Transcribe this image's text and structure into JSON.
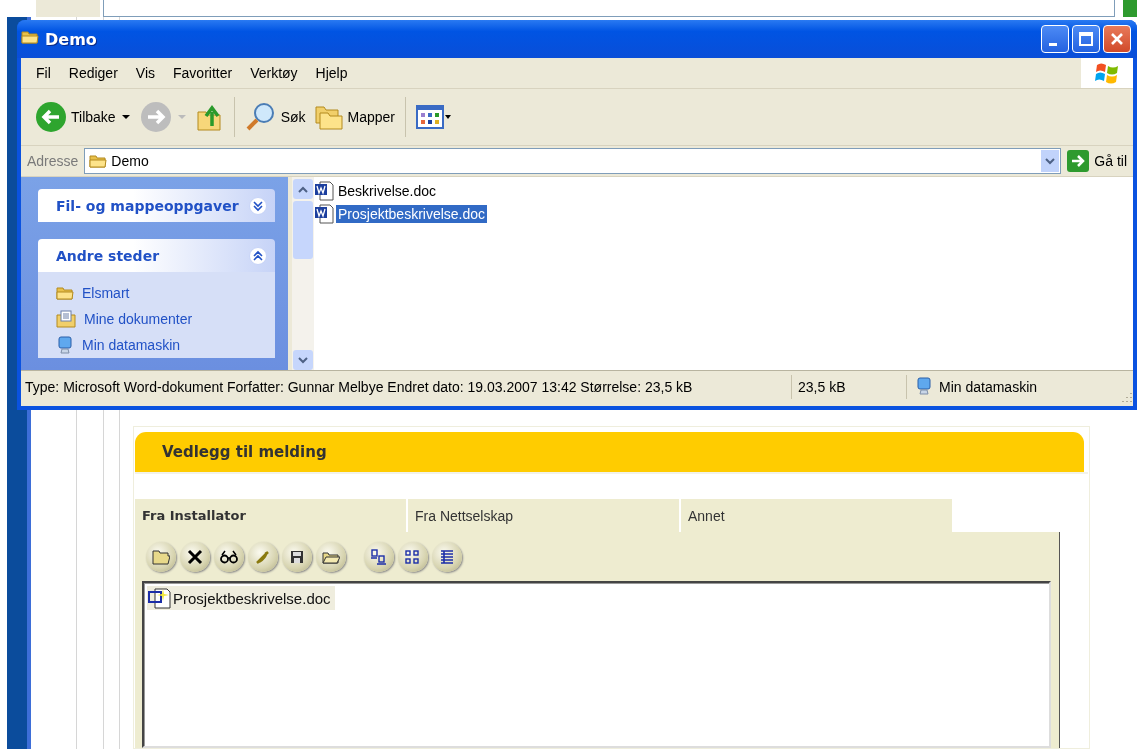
{
  "explorer": {
    "title": "Demo",
    "menu": [
      "Fil",
      "Rediger",
      "Vis",
      "Favoritter",
      "Verktøy",
      "Hjelp"
    ],
    "toolbar": [
      {
        "kind": "back",
        "label": "Tilbake",
        "disabled": false
      },
      {
        "kind": "forward",
        "disabled": true
      },
      {
        "kind": "up"
      },
      {
        "kind": "search",
        "label": "Søk"
      },
      {
        "kind": "folders",
        "label": "Mapper"
      },
      {
        "kind": "views"
      }
    ],
    "address": {
      "label": "Adresse",
      "value": "Demo",
      "go": "Gå til"
    },
    "task_panels": [
      {
        "title": "Fil- og mappeoppgaver",
        "expanded": false
      },
      {
        "title": "Andre steder",
        "expanded": true,
        "items": [
          {
            "label": "Elsmart",
            "kind": "folder"
          },
          {
            "label": "Mine dokumenter",
            "kind": "documents"
          },
          {
            "label": "Min datamaskin",
            "kind": "computer"
          }
        ]
      }
    ],
    "files": [
      {
        "name": "Beskrivelse.doc",
        "selected": false
      },
      {
        "name": "Prosjektbeskrivelse.doc",
        "selected": true
      }
    ],
    "status_bar": {
      "details": "Type: Microsoft Word-dokument Forfatter: Gunnar Melbye Endret dato: 19.03.2007 13:42 Størrelse: 23,5 kB",
      "size": "23,5 kB",
      "zone": "Min datamaskin"
    }
  },
  "attachments": {
    "title": "Vedlegg til melding",
    "tabs": [
      {
        "label": "Fra Installator",
        "selected": true
      },
      {
        "label": "Fra Nettselskap",
        "selected": false
      },
      {
        "label": "Annet",
        "selected": false
      }
    ],
    "toolbar_groups": [
      [
        {
          "kind": "open"
        },
        {
          "kind": "delete"
        },
        {
          "kind": "view"
        },
        {
          "kind": "edit"
        },
        {
          "kind": "save"
        },
        {
          "kind": "folder"
        }
      ],
      [
        {
          "kind": "large-icons"
        },
        {
          "kind": "small-icons"
        },
        {
          "kind": "details"
        }
      ]
    ],
    "files": [
      {
        "name": "Prosjektbeskrivelse.doc"
      }
    ]
  }
}
